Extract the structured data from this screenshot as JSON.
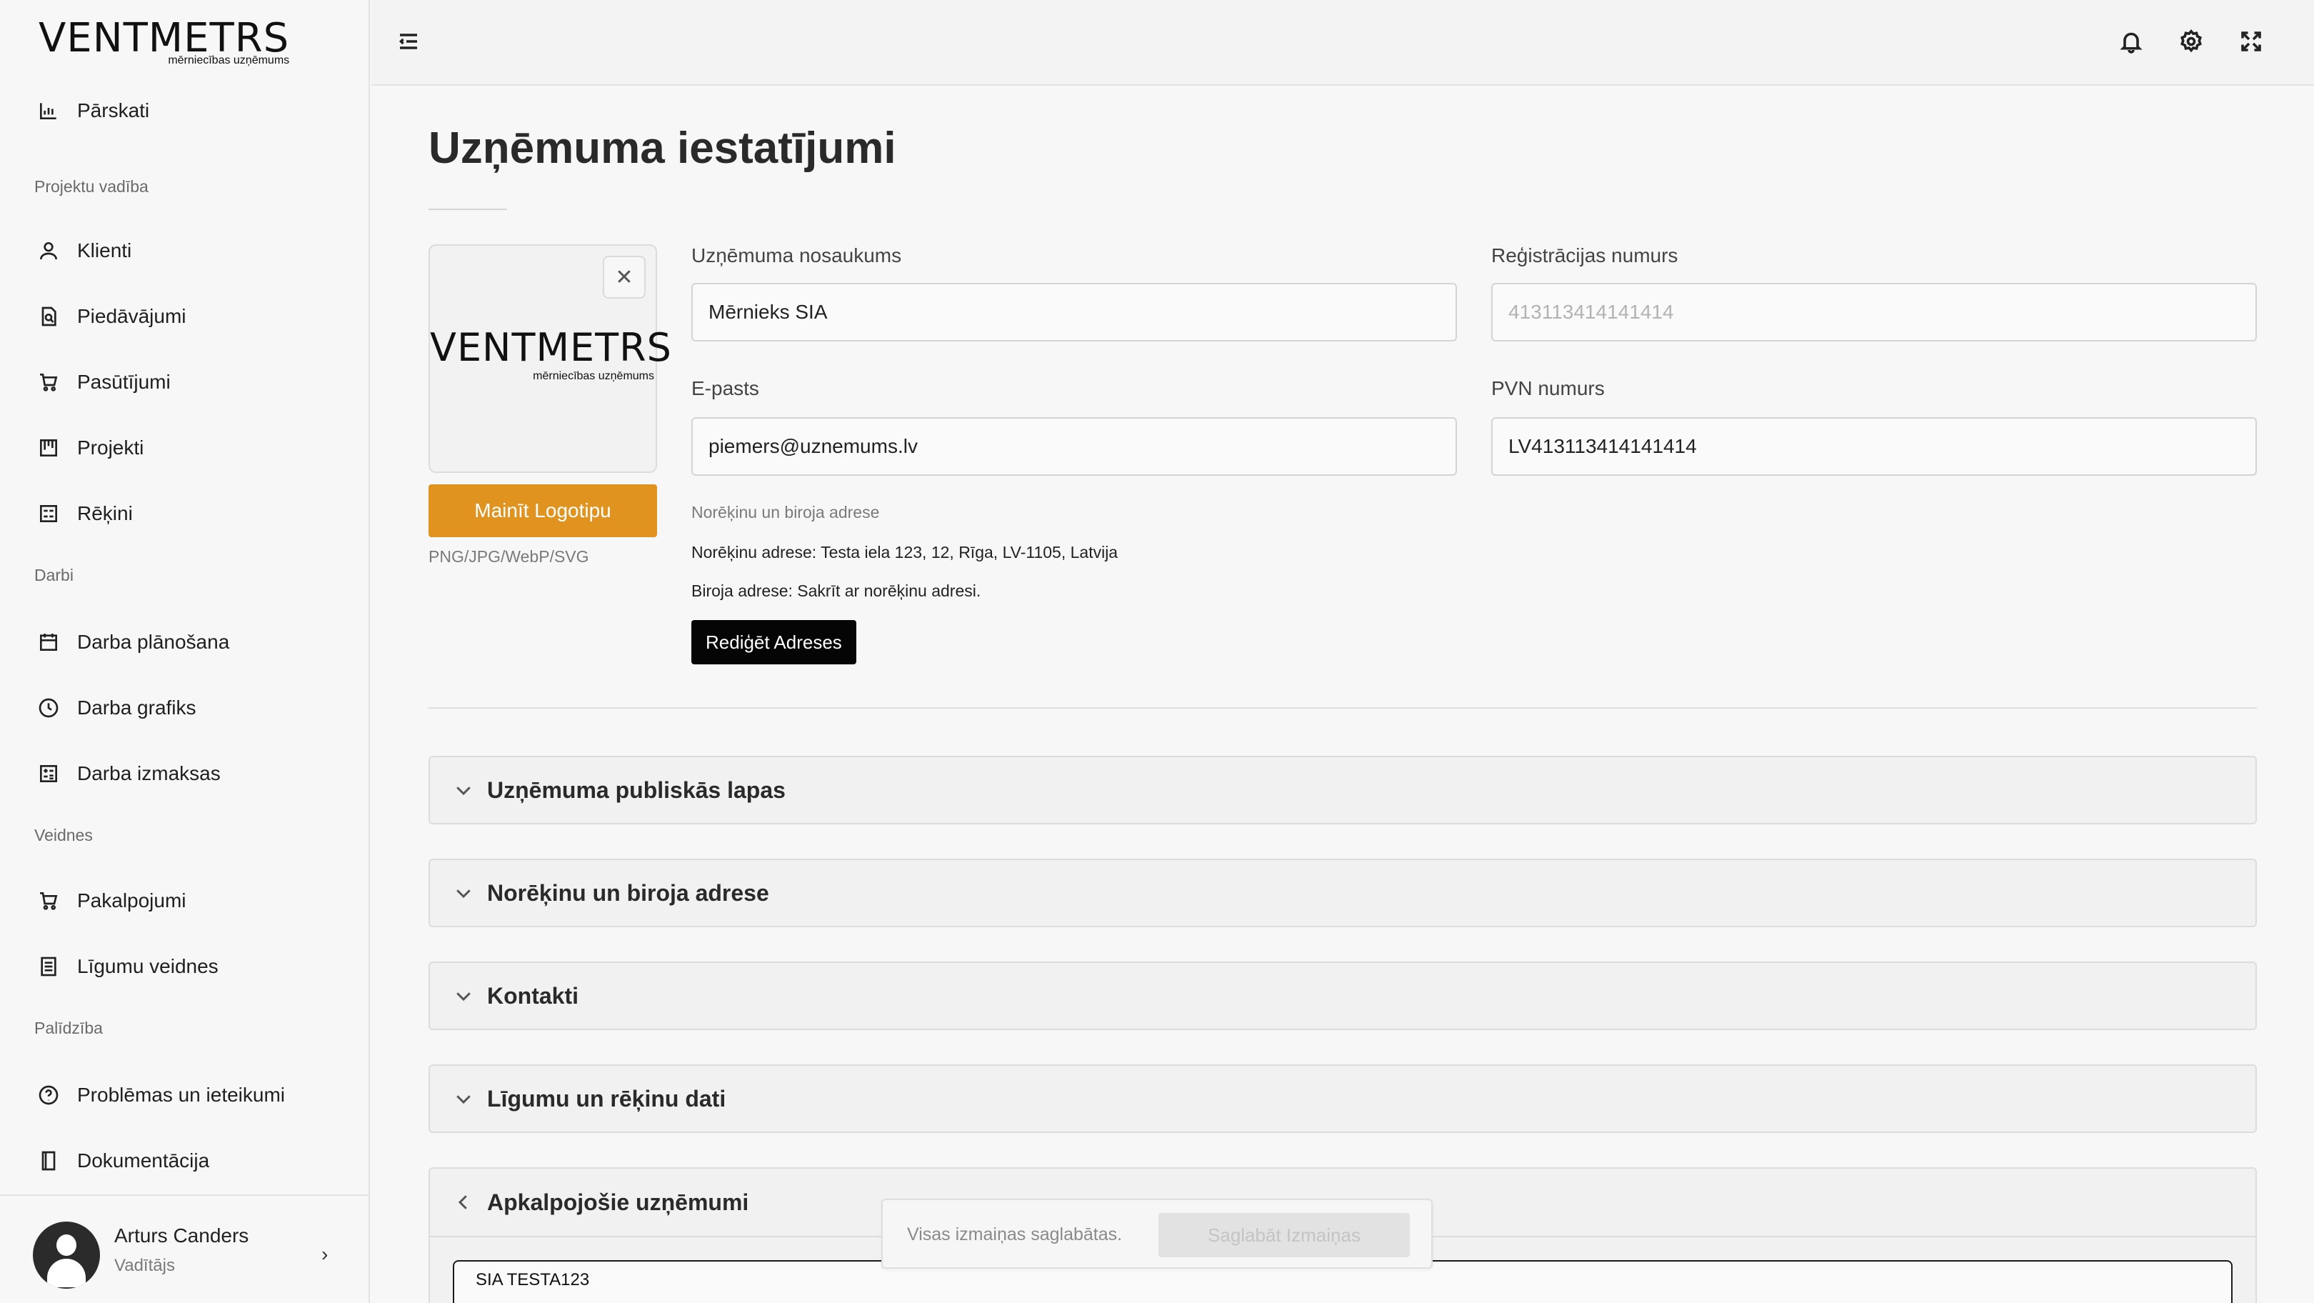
{
  "brand": {
    "name": "VENTMETRS",
    "tagline": "mērniecības uzņēmums"
  },
  "sidebar": {
    "items": [
      {
        "label": "Pārskati",
        "icon": "bar-chart-icon"
      },
      {
        "section": "Projektu vadība"
      },
      {
        "label": "Klienti",
        "icon": "user-icon"
      },
      {
        "label": "Piedāvājumi",
        "icon": "document-search-icon"
      },
      {
        "label": "Pasūtījumi",
        "icon": "cart-icon"
      },
      {
        "label": "Projekti",
        "icon": "kanban-icon"
      },
      {
        "label": "Rēķini",
        "icon": "invoice-icon"
      },
      {
        "section": "Darbi"
      },
      {
        "label": "Darba plānošana",
        "icon": "calendar-icon"
      },
      {
        "label": "Darba grafiks",
        "icon": "clock-icon"
      },
      {
        "label": "Darba izmaksas",
        "icon": "calculator-icon"
      },
      {
        "section": "Veidnes"
      },
      {
        "label": "Pakalpojumi",
        "icon": "cart-icon"
      },
      {
        "label": "Līgumu veidnes",
        "icon": "list-document-icon"
      },
      {
        "section": "Palīdzība"
      },
      {
        "label": "Problēmas un ieteikumi",
        "icon": "help-circle-icon"
      },
      {
        "label": "Dokumentācija",
        "icon": "book-icon"
      }
    ],
    "user": {
      "name": "Arturs Canders",
      "role": "Vadītājs"
    }
  },
  "header": {
    "icons": [
      "collapse-menu-icon",
      "bell-icon",
      "gear-icon",
      "fullscreen-icon"
    ]
  },
  "page": {
    "title": "Uzņēmuma iestatījumi",
    "logo": {
      "change_label": "Mainīt Logotipu",
      "formats": "PNG/JPG/WebP/SVG",
      "remove_icon": "close-icon"
    },
    "fields": {
      "company_name": {
        "label": "Uzņēmuma nosaukums",
        "value": "Mērnieks SIA"
      },
      "reg_number": {
        "label": "Reģistrācijas numurs",
        "placeholder": "413113414141414",
        "value": ""
      },
      "email": {
        "label": "E-pasts",
        "value": "piemers@uznemums.lv"
      },
      "vat_number": {
        "label": "PVN numurs",
        "value": "LV413113414141414"
      }
    },
    "address": {
      "label": "Norēķinu un biroja adrese",
      "billing": "Norēķinu adrese: Testa iela 123, 12, Rīga, LV-1105, Latvija",
      "office": "Biroja adrese: Sakrīt ar norēķinu adresi.",
      "edit_label": "Rediģēt Adreses"
    },
    "accordions": [
      {
        "title": "Uzņēmuma publiskās lapas",
        "expanded": false
      },
      {
        "title": "Norēķinu un biroja adrese",
        "expanded": false
      },
      {
        "title": "Kontakti",
        "expanded": false
      },
      {
        "title": "Līgumu un rēķinu dati",
        "expanded": false
      },
      {
        "title": "Apkalpojošie uzņēmumi",
        "expanded": true,
        "items": [
          "SIA TESTA123"
        ]
      }
    ],
    "save_bar": {
      "status": "Visas izmaiņas saglabātas.",
      "save_label": "Saglabāt Izmaiņas"
    }
  },
  "colors": {
    "accent": "#e0941f",
    "primary_button": "#050505",
    "background": "#f7f7f7"
  }
}
